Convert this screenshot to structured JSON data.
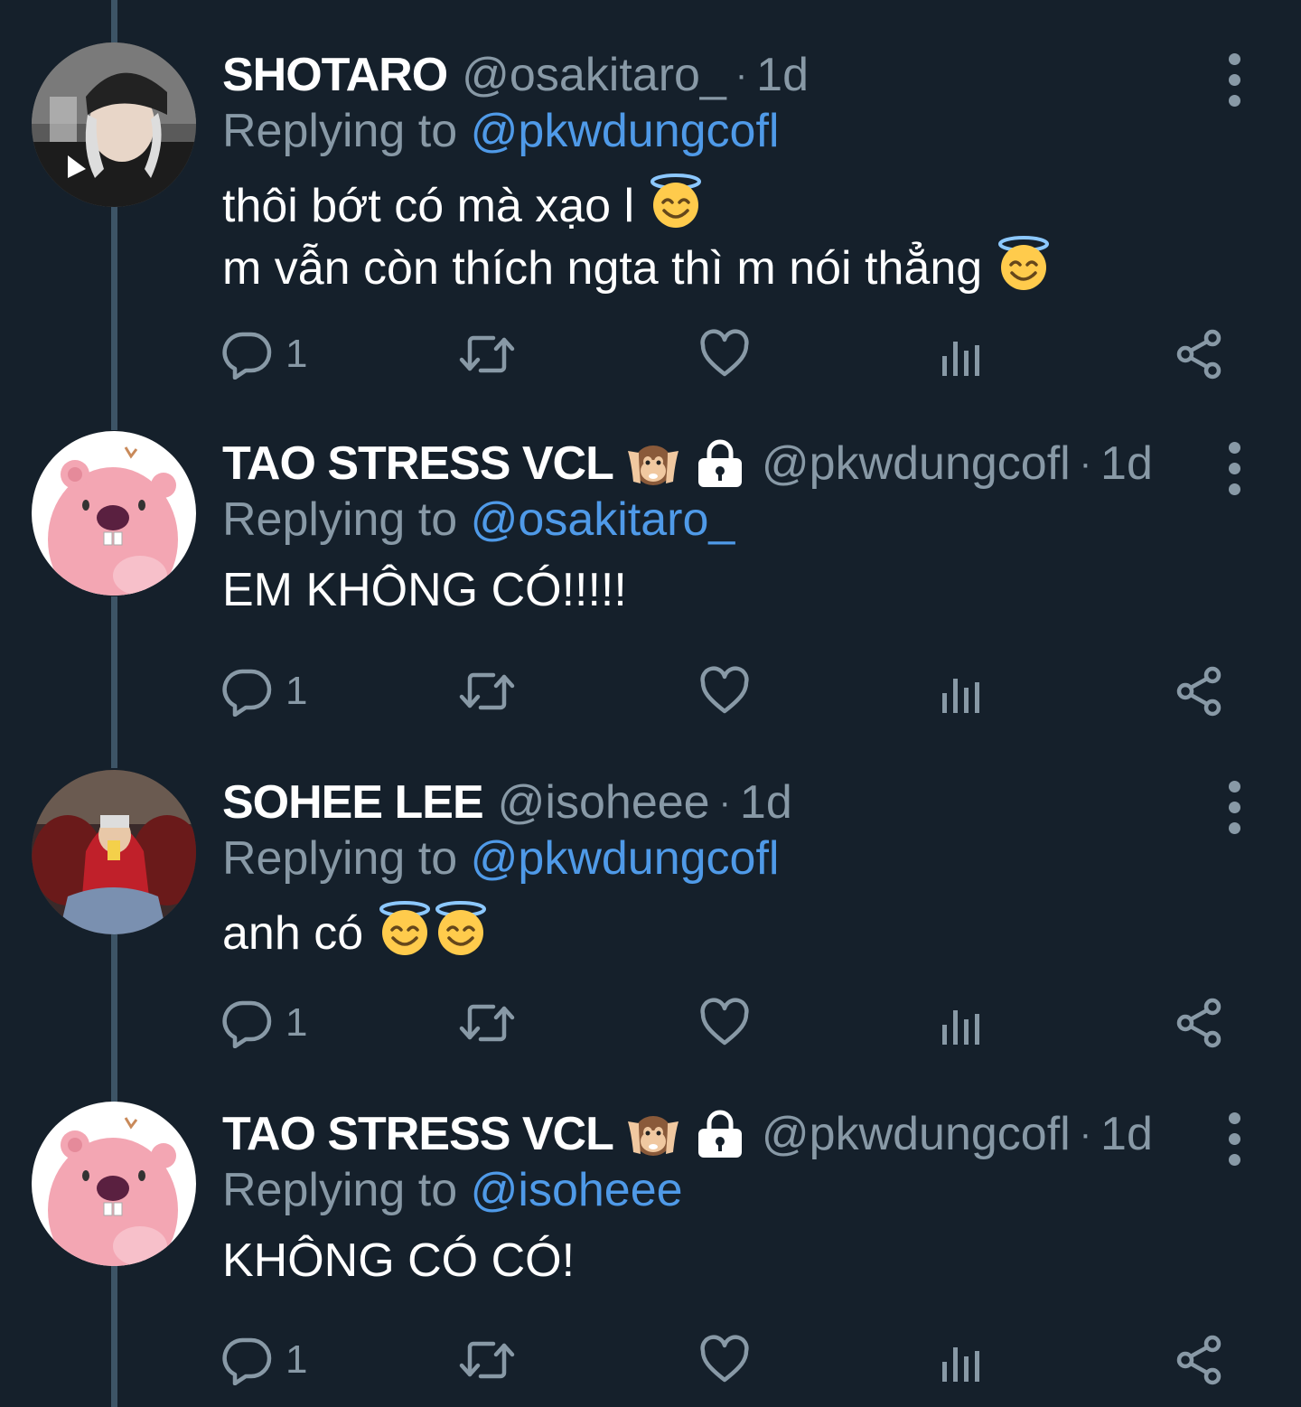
{
  "colors": {
    "background": "#15202b",
    "secondary_text": "#8899a6",
    "mention": "#4f9ae8",
    "thread_line": "#3d5466"
  },
  "tweets": [
    {
      "display_name": "SHOTARO",
      "badges": [],
      "handle": "@osakitaro_",
      "separator": "·",
      "time": "1d",
      "replying_prefix": "Replying to ",
      "replying_to": "@pkwdungcofl",
      "lines": [
        "thôi bớt có mà xạo l",
        "m vẫn còn thích ngta thì m nói thẳng"
      ],
      "reply_count": "1",
      "avatar": "photo-boy-cap"
    },
    {
      "display_name": "TAO STRESS VCL",
      "badges": [
        "hear-no-evil-monkey-emoji",
        "lock-icon"
      ],
      "handle": "@pkwdungcofl",
      "separator": "·",
      "time": "1d",
      "replying_prefix": "Replying to ",
      "replying_to": "@osakitaro_",
      "lines": [
        "EM KHÔNG CÓ!!!!!"
      ],
      "reply_count": "1",
      "avatar": "pink-beaver"
    },
    {
      "display_name": "SOHEE LEE",
      "badges": [],
      "handle": "@isoheee",
      "separator": "·",
      "time": "1d",
      "replying_prefix": "Replying to ",
      "replying_to": "@pkwdungcofl",
      "lines": [
        "anh có"
      ],
      "reply_count": "1",
      "avatar": "photo-red-hoodie"
    },
    {
      "display_name": "TAO STRESS VCL",
      "badges": [
        "hear-no-evil-monkey-emoji",
        "lock-icon"
      ],
      "handle": "@pkwdungcofl",
      "separator": "·",
      "time": "1d",
      "replying_prefix": "Replying to ",
      "replying_to": "@isoheee",
      "lines": [
        "KHÔNG CÓ CÓ!"
      ],
      "reply_count": "1",
      "avatar": "pink-beaver"
    }
  ],
  "icons": {
    "reply": "reply-icon",
    "retweet": "retweet-icon",
    "like": "heart-icon",
    "analytics": "analytics-icon",
    "share": "share-icon",
    "more": "more-vertical-icon",
    "emoji": "smiling-face-with-halo-emoji"
  }
}
